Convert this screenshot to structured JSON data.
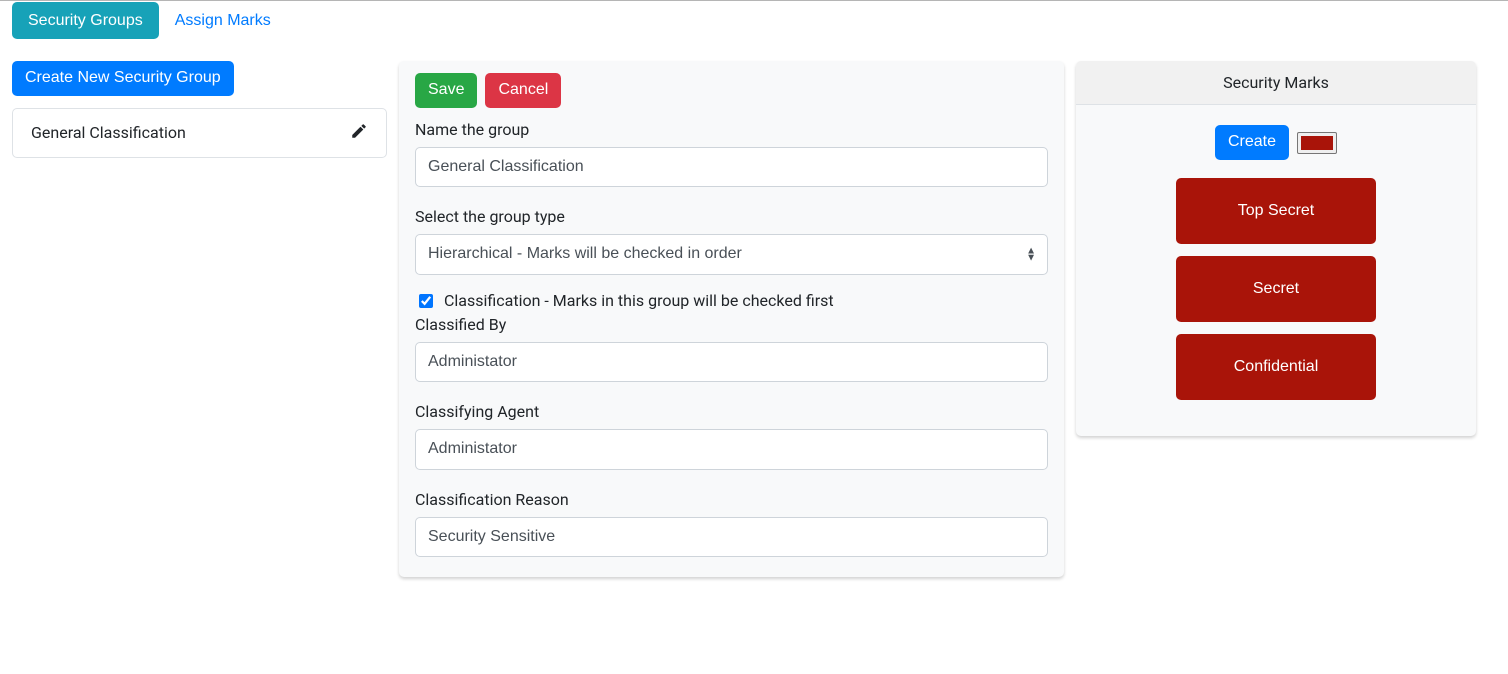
{
  "tabs": {
    "security_groups": "Security Groups",
    "assign_marks": "Assign Marks"
  },
  "left": {
    "create_button": "Create New Security Group",
    "items": [
      {
        "label": "General Classification"
      }
    ]
  },
  "form": {
    "save_label": "Save",
    "cancel_label": "Cancel",
    "name_label": "Name the group",
    "name_value": "General Classification",
    "type_label": "Select the group type",
    "type_value": "Hierarchical - Marks will be checked in order",
    "classification_checkbox_label": "Classification - Marks in this group will be checked first",
    "classification_checked": true,
    "classified_by_label": "Classified By",
    "classified_by_value": "Administator",
    "classifying_agent_label": "Classifying Agent",
    "classifying_agent_value": "Administator",
    "classification_reason_label": "Classification Reason",
    "classification_reason_value": "Security Sensitive"
  },
  "marks": {
    "header": "Security Marks",
    "create_label": "Create",
    "swatch_color": "#a91409",
    "items": [
      {
        "label": "Top Secret",
        "color": "#a91409"
      },
      {
        "label": "Secret",
        "color": "#a91409"
      },
      {
        "label": "Confidential",
        "color": "#a91409"
      }
    ]
  }
}
